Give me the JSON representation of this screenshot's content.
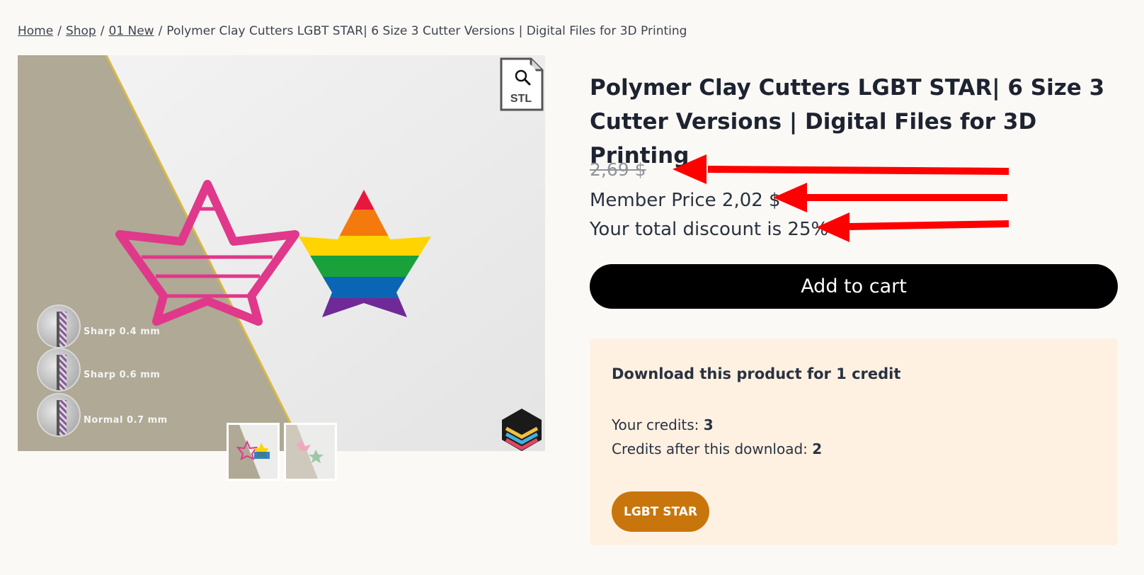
{
  "breadcrumb": {
    "home": "Home",
    "shop": "Shop",
    "category": "01 New",
    "current": "Polymer Clay Cutters LGBT STAR| 6 Size 3 Cutter Versions | Digital Files for 3D Printing",
    "separator": "/"
  },
  "gallery": {
    "badge_text": "STL",
    "sizes": [
      "Sharp 0.4 mm",
      "Sharp 0.6 mm",
      "Normal 0.7 mm"
    ],
    "zoom_icon": "search-icon"
  },
  "product": {
    "title": "Polymer Clay Cutters LGBT STAR| 6 Size 3 Cutter Versions | Digital Files for 3D Printing",
    "old_price": "2,69 $",
    "member_price": "Member Price 2,02 $",
    "discount": "Your total discount is 25%",
    "add_to_cart": "Add to cart"
  },
  "credits": {
    "heading": "Download this product for 1 credit",
    "your_credits_label": "Your credits:",
    "your_credits_value": "3",
    "after_label": "Credits after this download:",
    "after_value": "2",
    "button": "LGBT STAR"
  },
  "colors": {
    "accent_orange": "#c8760c",
    "arrow_red": "#ff0000",
    "credit_bg": "#fef1e2",
    "cutter_pink": "#e0388a"
  }
}
